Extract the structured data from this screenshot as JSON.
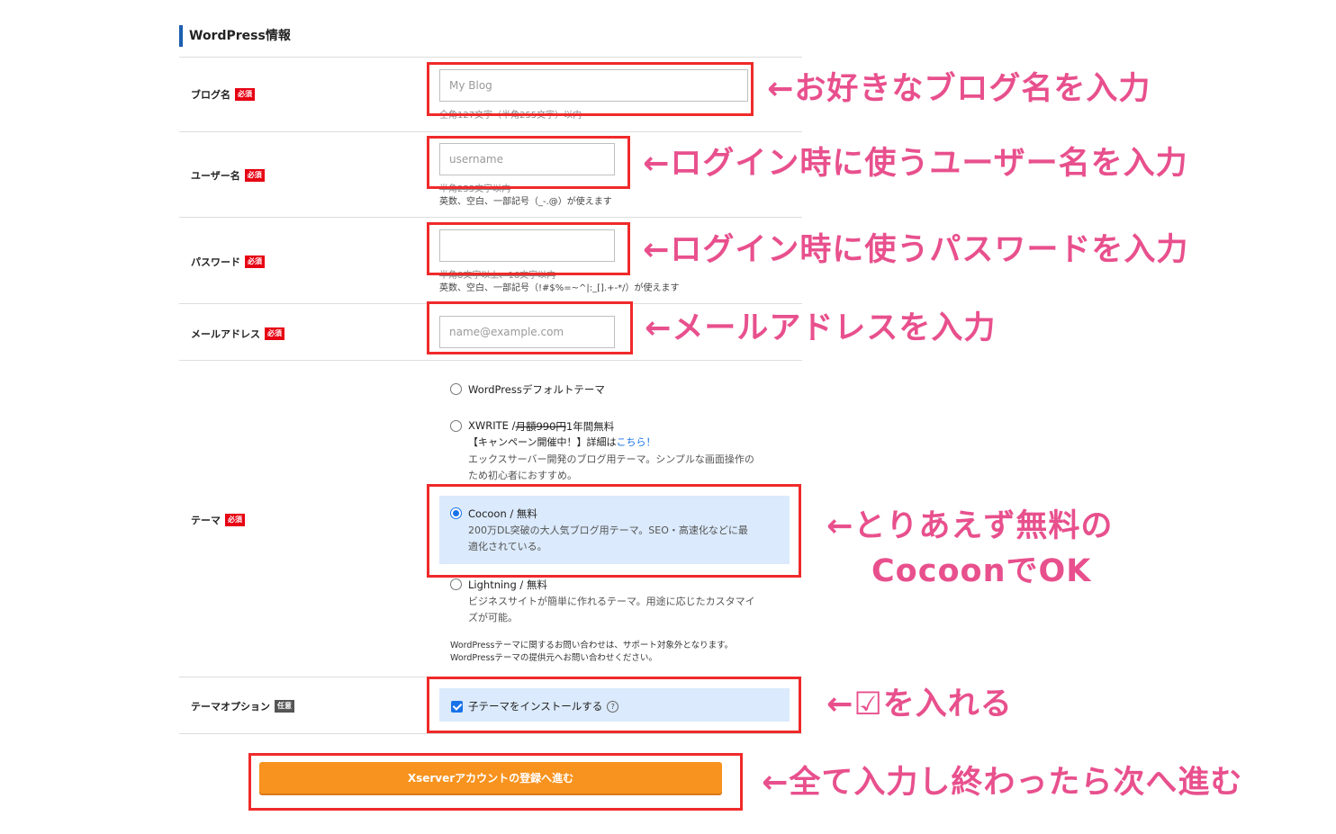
{
  "section": {
    "title": "WordPress情報"
  },
  "badges": {
    "required": "必須",
    "optional": "任意"
  },
  "fields": {
    "blog_name": {
      "label": "ブログ名",
      "placeholder": "My Blog",
      "hint": "全角127文字（半角255文字）以内"
    },
    "username": {
      "label": "ユーザー名",
      "placeholder": "username",
      "hint1": "半角255文字以内",
      "hint2": "英数、空白、一部記号（_-.@）が使えます"
    },
    "password": {
      "label": "パスワード",
      "placeholder": "",
      "hint1": "半角8文字以上、16文字以内",
      "hint2": "英数、空白、一部記号（!#$%=~^|:_[].+-*/）が使えます"
    },
    "email": {
      "label": "メールアドレス",
      "placeholder": "name@example.com"
    }
  },
  "theme": {
    "label": "テーマ",
    "options": [
      {
        "name": "WordPressデフォルトテーマ"
      },
      {
        "name": "XWRITE / ",
        "price_struck": "月額990円",
        "price": " 1年間無料",
        "campaign": "【キャンペーン開催中！】詳細は",
        "campaign_link": "こちら！",
        "desc1": "エックスサーバー開発のブログ用テーマ。シンプルな画面操作の",
        "desc2": "ため初心者におすすめ。"
      },
      {
        "name": "Cocoon / 無料",
        "desc1": "200万DL突破の大人気ブログ用テーマ。SEO・高速化などに最",
        "desc2": "適化されている。",
        "selected": true
      },
      {
        "name": "Lightning / 無料",
        "desc1": "ビジネスサイトが簡単に作れるテーマ。用途に応じたカスタマイ",
        "desc2": "ズが可能。"
      }
    ],
    "note1": "WordPressテーマに関するお問い合わせは、サポート対象外となります。",
    "note2": "WordPressテーマの提供元へお問い合わせください。"
  },
  "theme_option": {
    "label": "テーマオプション",
    "checkbox_label": "子テーマをインストールする",
    "help": "?",
    "checked": true
  },
  "submit": {
    "label": "Xserverアカウントの登録へ進む"
  },
  "annotations": {
    "blog_name": "←お好きなブログ名を入力",
    "username": "←ログイン時に使うユーザー名を入力",
    "password": "←ログイン時に使うパスワードを入力",
    "email": "←メールアドレスを入力",
    "theme_line1": "←とりあえず無料の",
    "theme_line2": "CocoonでOK",
    "checkbox": "←☑を入れる",
    "submit": "←全て入力し終わったら次へ進む"
  },
  "colors": {
    "annotation": "#e8508d",
    "highlight_box": "#f02a2a",
    "submit": "#f7931e",
    "accent": "#1b5fae",
    "selected_bg": "#dbeafc"
  }
}
